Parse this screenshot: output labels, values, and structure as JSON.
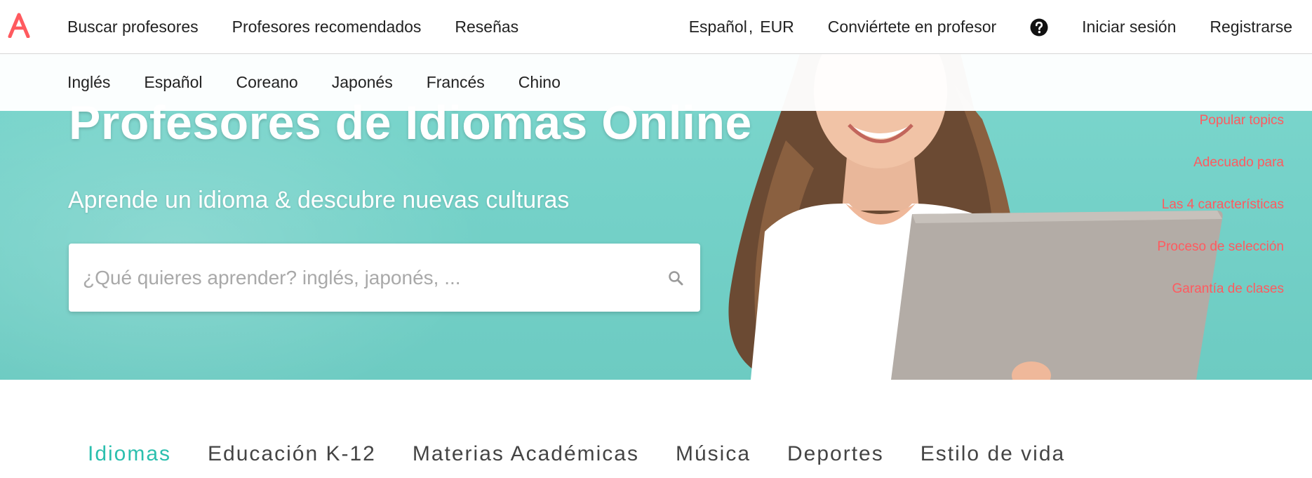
{
  "brand": {
    "logo_letter": "A",
    "accent": "#ff5a5f",
    "teal": "#2bbfae"
  },
  "topnav": {
    "left_links": [
      "Buscar profesores",
      "Profesores recomendados",
      "Reseñas"
    ],
    "language": "Español",
    "separator": ",",
    "currency": "EUR",
    "become_teacher": "Conviértete en profesor",
    "help_icon": "question-circle-icon",
    "login": "Iniciar sesión",
    "signup": "Registrarse"
  },
  "subnav": {
    "languages": [
      "Inglés",
      "Español",
      "Coreano",
      "Japonés",
      "Francés",
      "Chino"
    ]
  },
  "hero": {
    "title": "Profesores de Idiomas Online",
    "subtitle": "Aprende un idioma & descubre nuevas culturas",
    "search": {
      "placeholder": "¿Qué quieres aprender? inglés, japonés, ...",
      "value": "",
      "icon": "search-icon"
    },
    "side_links": [
      "Popular topics",
      "Adecuado para",
      "Las 4 características",
      "Proceso de selección",
      "Garantía de clases"
    ]
  },
  "categories": {
    "active": "Idiomas",
    "tabs": [
      "Idiomas",
      "Educación K-12",
      "Materias Académicas",
      "Música",
      "Deportes",
      "Estilo de vida"
    ]
  }
}
